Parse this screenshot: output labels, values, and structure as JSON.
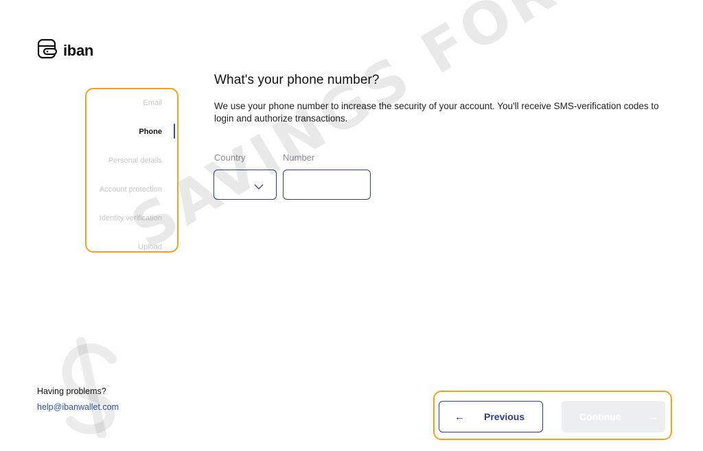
{
  "brand": {
    "name": "iban",
    "logo_icon": "wallet-icon"
  },
  "steps": [
    {
      "label": "Email",
      "active": false
    },
    {
      "label": "Phone",
      "active": true
    },
    {
      "label": "Personal details",
      "active": false
    },
    {
      "label": "Account protection",
      "active": false
    },
    {
      "label": "Identity verification",
      "active": false
    },
    {
      "label": "Upload",
      "active": false
    }
  ],
  "main": {
    "title": "What's your phone number?",
    "description": "We use your phone number to increase the security of your account. You'll receive SMS-verification codes to login and authorize transactions."
  },
  "form": {
    "country_label": "Country",
    "country_value": "",
    "number_label": "Number",
    "number_value": "",
    "number_placeholder": ""
  },
  "help": {
    "title": "Having problems?",
    "email": "help@ibanwallet.com"
  },
  "nav": {
    "previous_label": "Previous",
    "previous_icon": "arrow-left-icon",
    "continue_label": "Continue",
    "continue_icon": "arrow-right-icon",
    "continue_enabled": false
  },
  "watermark": {
    "text": "SAVINGS FOR FREEDOM"
  },
  "colors": {
    "accent": "#2e3f7a",
    "link": "#2d4fb0",
    "highlight": "#f5a020",
    "disabled_button": "#eceef0",
    "inactive_step": "#c4c7cd"
  }
}
